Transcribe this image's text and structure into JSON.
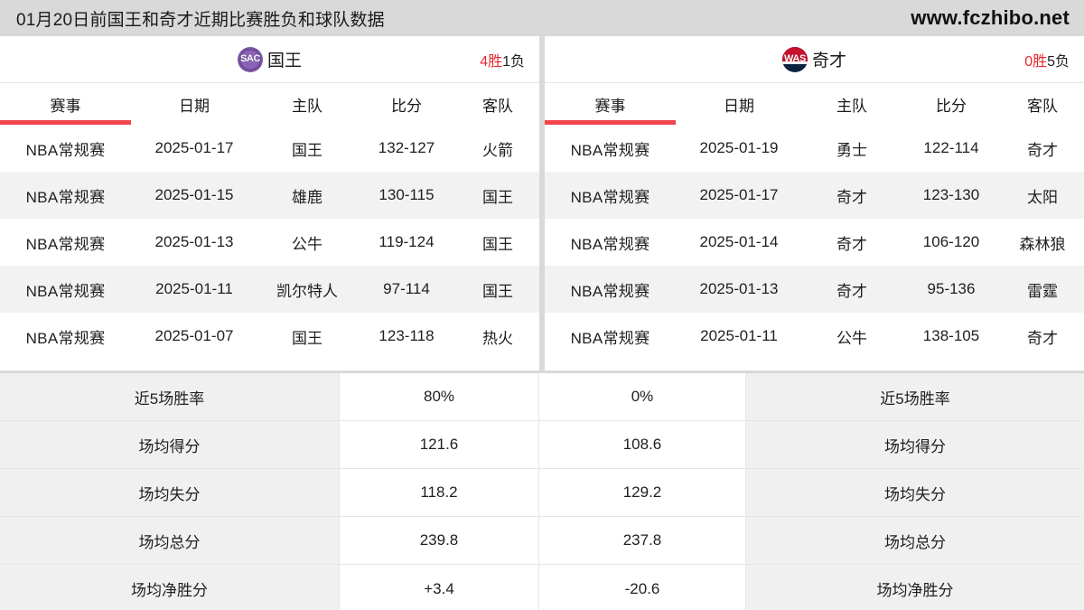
{
  "header": {
    "page_title": "01月20日前国王和奇才近期比赛胜负和球队数据",
    "site": "www.fczhibo.net"
  },
  "accent_colors": {
    "badge_red": "#f7464a",
    "badge_red_alt": "#ea3437",
    "underline_red": "#f2454a",
    "record_win_red": "#e8272c",
    "page_background": "#d9d9d9"
  },
  "panels": [
    {
      "side": "left",
      "team": {
        "name": "国王",
        "logo_text": "SAC",
        "logo_icon": "sacramento-kings-logo-icon",
        "record_wins": "4胜",
        "record_losses": "1负"
      },
      "columns": [
        "赛事",
        "日期",
        "主队",
        "比分",
        "客队"
      ],
      "rows": [
        {
          "league": "NBA常规赛",
          "date": "2025-01-17",
          "home": "国王",
          "score": "132-127",
          "away": "火箭"
        },
        {
          "league": "NBA常规赛",
          "date": "2025-01-15",
          "home": "雄鹿",
          "score": "130-115",
          "away": "国王"
        },
        {
          "league": "NBA常规赛",
          "date": "2025-01-13",
          "home": "公牛",
          "score": "119-124",
          "away": "国王"
        },
        {
          "league": "NBA常规赛",
          "date": "2025-01-11",
          "home": "凯尔特人",
          "score": "97-114",
          "away": "国王"
        },
        {
          "league": "NBA常规赛",
          "date": "2025-01-07",
          "home": "国王",
          "score": "123-118",
          "away": "热火"
        }
      ]
    },
    {
      "side": "right",
      "team": {
        "name": "奇才",
        "logo_text": "WAS",
        "logo_icon": "washington-wizards-logo-icon",
        "record_wins": "0胜",
        "record_losses": "5负"
      },
      "columns": [
        "赛事",
        "日期",
        "主队",
        "比分",
        "客队"
      ],
      "rows": [
        {
          "league": "NBA常规赛",
          "date": "2025-01-19",
          "home": "勇士",
          "score": "122-114",
          "away": "奇才"
        },
        {
          "league": "NBA常规赛",
          "date": "2025-01-17",
          "home": "奇才",
          "score": "123-130",
          "away": "太阳"
        },
        {
          "league": "NBA常规赛",
          "date": "2025-01-14",
          "home": "奇才",
          "score": "106-120",
          "away": "森林狼"
        },
        {
          "league": "NBA常规赛",
          "date": "2025-01-13",
          "home": "奇才",
          "score": "95-136",
          "away": "雷霆"
        },
        {
          "league": "NBA常规赛",
          "date": "2025-01-11",
          "home": "公牛",
          "score": "138-105",
          "away": "奇才"
        }
      ]
    }
  ],
  "stats": [
    {
      "label_left": "近5场胜率",
      "value_left": "80%",
      "value_right": "0%",
      "label_right": "近5场胜率"
    },
    {
      "label_left": "场均得分",
      "value_left": "121.6",
      "value_right": "108.6",
      "label_right": "场均得分"
    },
    {
      "label_left": "场均失分",
      "value_left": "118.2",
      "value_right": "129.2",
      "label_right": "场均失分"
    },
    {
      "label_left": "场均总分",
      "value_left": "239.8",
      "value_right": "237.8",
      "label_right": "场均总分"
    },
    {
      "label_left": "场均净胜分",
      "value_left": "+3.4",
      "value_right": "-20.6",
      "label_right": "场均净胜分"
    }
  ]
}
